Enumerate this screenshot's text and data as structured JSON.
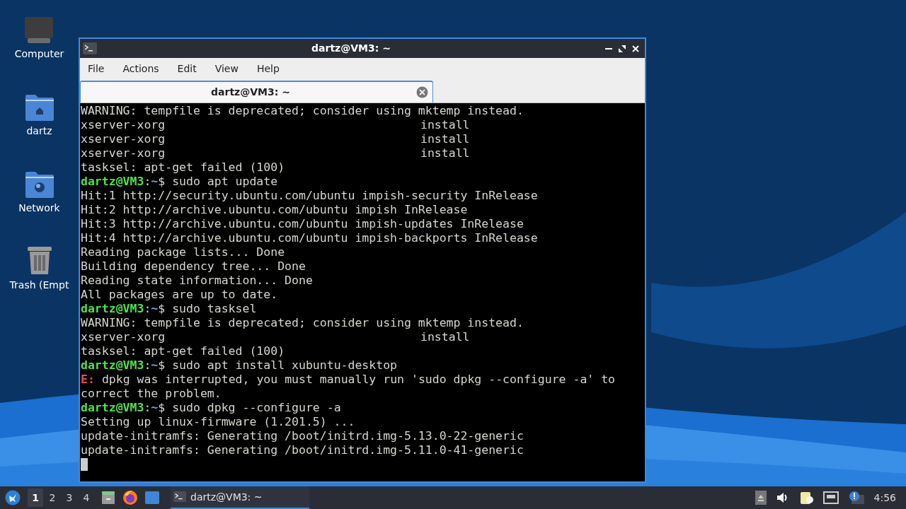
{
  "desktop_icons": [
    {
      "kind": "computer",
      "label": "Computer"
    },
    {
      "kind": "home",
      "label": "dartz"
    },
    {
      "kind": "network",
      "label": "Network"
    },
    {
      "kind": "trash",
      "label": "Trash (Empt"
    }
  ],
  "window": {
    "title": "dartz@VM3: ~",
    "menu": [
      "File",
      "Actions",
      "Edit",
      "View",
      "Help"
    ],
    "tabs": [
      {
        "title": "dartz@VM3: ~",
        "selected": true
      }
    ],
    "lines": [
      {
        "kind": "plain",
        "text": "WARNING: tempfile is deprecated; consider using mktemp instead."
      },
      {
        "kind": "columns",
        "text": "xserver-xorg",
        "value": "install"
      },
      {
        "kind": "columns",
        "text": "xserver-xorg",
        "value": "install"
      },
      {
        "kind": "columns",
        "text": "xserver-xorg",
        "value": "install"
      },
      {
        "kind": "plain",
        "text": "tasksel: apt-get failed (100)"
      },
      {
        "kind": "prompt",
        "host": "dartz@VM3",
        "sep": ":",
        "path": "~",
        "text": "$ sudo apt update"
      },
      {
        "kind": "plain",
        "text": "Hit:1 http://security.ubuntu.com/ubuntu impish-security InRelease"
      },
      {
        "kind": "plain",
        "text": "Hit:2 http://archive.ubuntu.com/ubuntu impish InRelease"
      },
      {
        "kind": "plain",
        "text": "Hit:3 http://archive.ubuntu.com/ubuntu impish-updates InRelease"
      },
      {
        "kind": "plain",
        "text": "Hit:4 http://archive.ubuntu.com/ubuntu impish-backports InRelease"
      },
      {
        "kind": "plain",
        "text": "Reading package lists... Done"
      },
      {
        "kind": "plain",
        "text": "Building dependency tree... Done"
      },
      {
        "kind": "plain",
        "text": "Reading state information... Done"
      },
      {
        "kind": "plain",
        "text": "All packages are up to date."
      },
      {
        "kind": "prompt",
        "host": "dartz@VM3",
        "sep": ":",
        "path": "~",
        "text": "$ sudo tasksel"
      },
      {
        "kind": "plain",
        "text": "WARNING: tempfile is deprecated; consider using mktemp instead."
      },
      {
        "kind": "columns",
        "text": "xserver-xorg",
        "value": "install"
      },
      {
        "kind": "plain",
        "text": "tasksel: apt-get failed (100)"
      },
      {
        "kind": "prompt",
        "host": "dartz@VM3",
        "sep": ":",
        "path": "~",
        "text": "$ sudo apt install xubuntu-desktop"
      },
      {
        "kind": "error",
        "tag": "E:",
        "text": "dpkg was interrupted, you must manually run 'sudo dpkg --configure -a' to"
      },
      {
        "kind": "plain",
        "text": "correct the problem."
      },
      {
        "kind": "prompt",
        "host": "dartz@VM3",
        "sep": ":",
        "path": "~",
        "text": "$ sudo dpkg --configure -a"
      },
      {
        "kind": "plain",
        "text": "Setting up linux-firmware (1.201.5) ..."
      },
      {
        "kind": "plain",
        "text": "update-initramfs: Generating /boot/initrd.img-5.13.0-22-generic"
      },
      {
        "kind": "plain",
        "text": "update-initramfs: Generating /boot/initrd.img-5.11.0-41-generic"
      }
    ]
  },
  "taskbar": {
    "workspaces": [
      {
        "label": "1",
        "selected": true
      },
      {
        "label": "2",
        "selected": false
      },
      {
        "label": "3",
        "selected": false
      },
      {
        "label": "4",
        "selected": false
      }
    ],
    "tasks": [
      {
        "title": "dartz@VM3: ~",
        "selected": true
      }
    ],
    "clock": "4:56"
  }
}
